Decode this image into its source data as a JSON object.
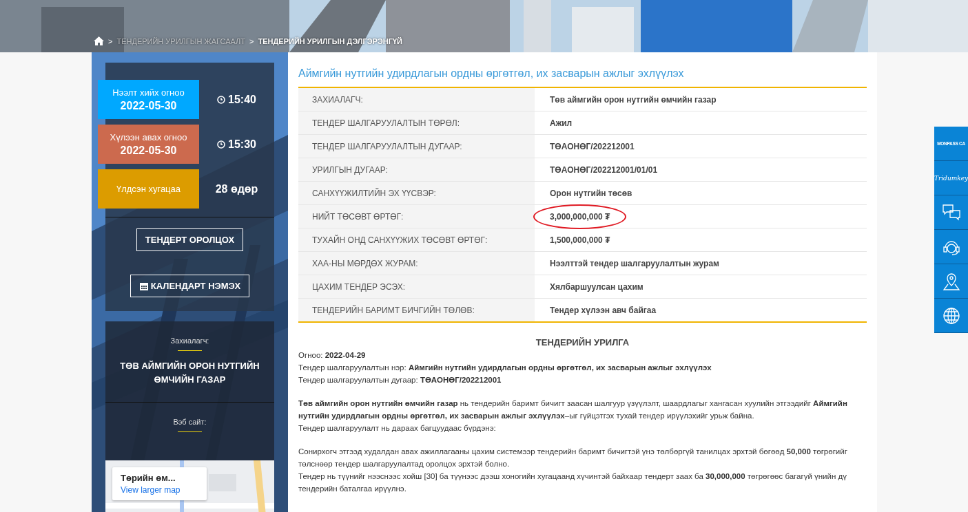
{
  "breadcrumb": [
    {
      "separator": ">",
      "label": "ТЕНДЕРИЙН УРИЛГЫН ЖАГСААЛТ",
      "current": false
    },
    {
      "separator": ">",
      "label": "ТЕНДЕРИЙН УРИЛГЫН ДЭЛГЭРЭНГҮЙ",
      "current": true
    }
  ],
  "dates": [
    {
      "kind": "date",
      "label": "Нээлт хийх огноо",
      "date": "2022-05-30",
      "time": "15:40",
      "color": "#00a8ff"
    },
    {
      "kind": "date",
      "label": "Хүлээн авах огноо",
      "date": "2022-05-30",
      "time": "15:30",
      "color": "#cc6a4e"
    },
    {
      "kind": "remaining",
      "label": "Үлдсэн хугацаа",
      "value": "28 өдөр",
      "color": "#dc9c00"
    }
  ],
  "actions": [
    {
      "kind": "participate",
      "label": "ТЕНДЕРТ ОРОЛЦОХ"
    },
    {
      "kind": "calendar",
      "label": "КАЛЕНДАРТ НЭМЭХ"
    }
  ],
  "customer": {
    "caption": "Захиалагч:",
    "name": "ТӨВ АЙМГИЙН ОРОН НУТГИЙН ӨМЧИЙН ГАЗАР"
  },
  "website": {
    "caption": "Вэб сайт:"
  },
  "map": {
    "place": "Төрийн өм...",
    "link": "View larger map"
  },
  "title": "Аймгийн нутгийн удирдлагын ордны өргөтгөл, их засварын ажлыг эхлүүлэх",
  "details": [
    {
      "label": "ЗАХИАЛАГЧ:",
      "value": "Төв аймгийн орон нутгийн өмчийн газар",
      "circled": false
    },
    {
      "label": "ТЕНДЕР ШАЛГАРУУЛАЛТЫН ТӨРӨЛ:",
      "value": "Ажил",
      "circled": false
    },
    {
      "label": "ТЕНДЕР ШАЛГАРУУЛАЛТЫН ДУГААР:",
      "value": "ТӨАОНӨГ/202212001",
      "circled": false
    },
    {
      "label": "УРИЛГЫН ДУГААР:",
      "value": "ТӨАОНӨГ/202212001/01/01",
      "circled": false
    },
    {
      "label": "САНХҮҮЖИЛТИЙН ЭХ ҮҮСВЭР:",
      "value": "Орон нутгийн төсөв",
      "circled": false
    },
    {
      "label": "НИЙТ ТӨСӨВТ ӨРТӨГ:",
      "value": "3,000,000,000 ₮",
      "circled": true
    },
    {
      "label": "ТУХАЙН ОНД САНХҮҮЖИХ ТӨСӨВТ ӨРТӨГ:",
      "value": "1,500,000,000 ₮",
      "circled": false
    },
    {
      "label": "ХАА-НЫ МӨРДӨХ ЖУРАМ:",
      "value": "Нээлттэй тендер шалгаруулалтын журам",
      "circled": false
    },
    {
      "label": "ЦАХИМ ТЕНДЕР ЭСЭХ:",
      "value": "Хялбаршуулсан цахим",
      "circled": false
    },
    {
      "label": "ТЕНДЕРИЙН БАРИМТ БИЧГИЙН ТӨЛӨВ:",
      "value": "Тендер хүлээн авч байгаа",
      "circled": false
    }
  ],
  "notice": {
    "heading": "ТЕНДЕРИЙН УРИЛГА",
    "paragraphs": [
      [
        "Огноо: **2022-04-29**",
        "Тендер шалгаруулалтын нэр: **Аймгийн нутгийн удирдлагын ордны өргөтгөл, их засварын ажлыг эхлүүлэх**",
        "Тендер шалгаруулалтын дугаар: **ТӨАОНӨГ/202212001**"
      ],
      [
        "**Төв аймгийн орон нутгийн өмчийн газар** нь тендерийн баримт бичигт заасан шалгуур үзүүлэлт, шаардлагыг хангасан хуулийн этгээдийг **Аймгийн нутгийн удирдлагын ордны өргөтгөл, их засварын ажлыг эхлүүлэх**–ыг гүйцэтгэх тухай тендер ирүүлэхийг урьж байна.",
        "Тендер шалгаруулалт нь дараах багцуудаас бүрдэнэ:"
      ],
      [
        "Сонирхогч этгээд худалдан авах ажиллагааны цахим системээр тендерийн баримт бичигтэй үнэ төлбөргүй танилцах эрхтэй бөгөөд **50,000** төгрөгийг төлснөөр тендер шалгаруулалтад оролцох эрхтэй болно.",
        "Тендер нь түүнийг нээснээс хойш [30] ба түүнээс дээш хоногийн хугацаанд хүчинтэй байхаар тендерт заах ба **30,000,000** төгрөгөөс багагүй үнийн дү",
        "тендерийн баталгаа ирүүлнэ."
      ]
    ]
  },
  "side_tools": [
    {
      "kind": "logo",
      "label": "MONPASS CA"
    },
    {
      "kind": "script",
      "label": "Tridumkey"
    },
    {
      "kind": "chat"
    },
    {
      "kind": "support"
    },
    {
      "kind": "location"
    },
    {
      "kind": "globe"
    }
  ]
}
